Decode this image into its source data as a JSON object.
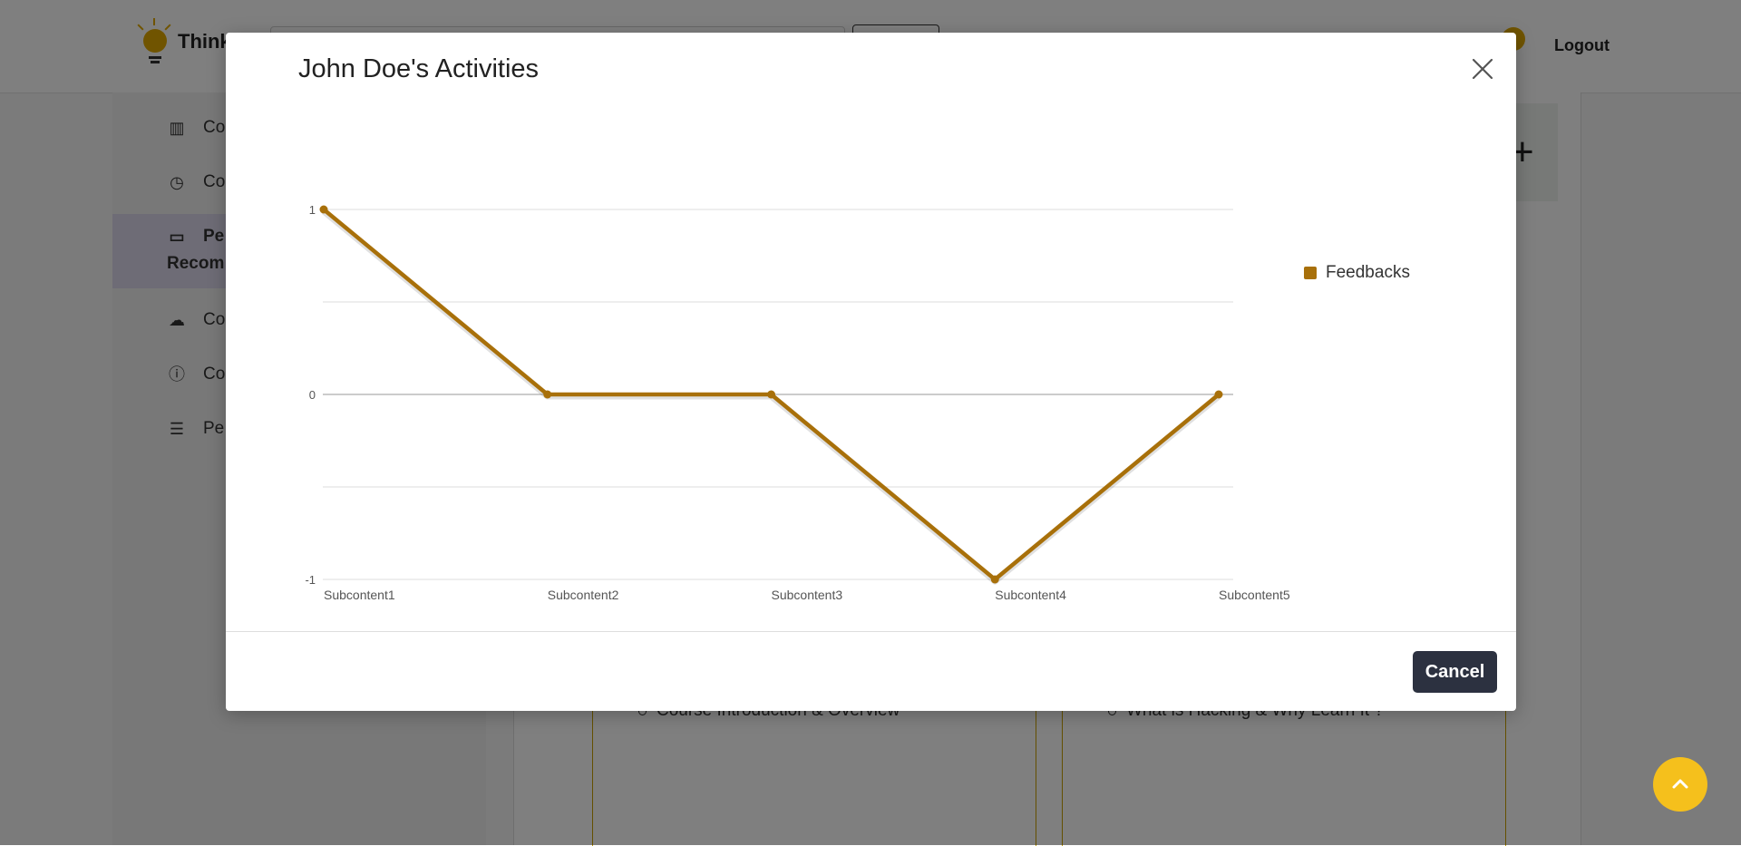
{
  "background": {
    "brand": "Think",
    "logout_label": "Logout",
    "sidebar_items": [
      {
        "label": "Co",
        "icon": "bar-chart-icon"
      },
      {
        "label": "Co",
        "icon": "clock-icon"
      },
      {
        "label": "Pe",
        "label2": "Recom",
        "icon": "monitor-icon"
      },
      {
        "label": "Co",
        "icon": "comments-icon"
      },
      {
        "label": "Co",
        "icon": "info-icon"
      },
      {
        "label": "Pe",
        "icon": "list-icon"
      }
    ],
    "course_items": [
      "Course Introduction & Overview",
      "What is Hacking & Why Learn It ?"
    ],
    "plus_icon": "plus-icon"
  },
  "modal": {
    "title": "John Doe's Activities",
    "close_icon": "close-icon",
    "cancel_label": "Cancel"
  },
  "chart_data": {
    "type": "line",
    "categories": [
      "Subcontent1",
      "Subcontent2",
      "Subcontent3",
      "Subcontent4",
      "Subcontent5"
    ],
    "series": [
      {
        "name": "Feedbacks",
        "values": [
          1,
          0,
          0,
          -1,
          0
        ],
        "color": "#a8700a"
      }
    ],
    "y_ticks": [
      "1",
      "0",
      "-1"
    ],
    "ylim": [
      -1,
      1
    ],
    "grid": true,
    "legend_position": "right"
  },
  "scroll_top_icon": "chevron-up-icon"
}
